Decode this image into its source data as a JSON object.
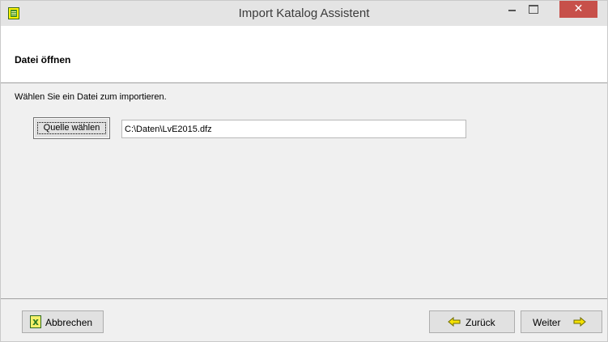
{
  "window": {
    "title": "Import Katalog Assistent",
    "close_glyph": "✕"
  },
  "header": {
    "title": "Datei öffnen"
  },
  "main": {
    "instruction": "Wählen Sie ein Datei zum importieren.",
    "source_button_label": "Quelle wählen",
    "path_value": "C:\\Daten\\LvE2015.dfz"
  },
  "footer": {
    "cancel_label": "Abbrechen",
    "back_label": "Zurück",
    "next_label": "Weiter"
  },
  "icons": {
    "app": "catalog-app-icon",
    "cancel": "excel-cancel-icon",
    "back": "arrow-left-icon",
    "next": "arrow-right-icon"
  },
  "colors": {
    "close_button": "#c7504a",
    "arrow_yellow": "#f6e200",
    "header_bg": "#ffffff",
    "window_bg": "#f0f0f0"
  }
}
